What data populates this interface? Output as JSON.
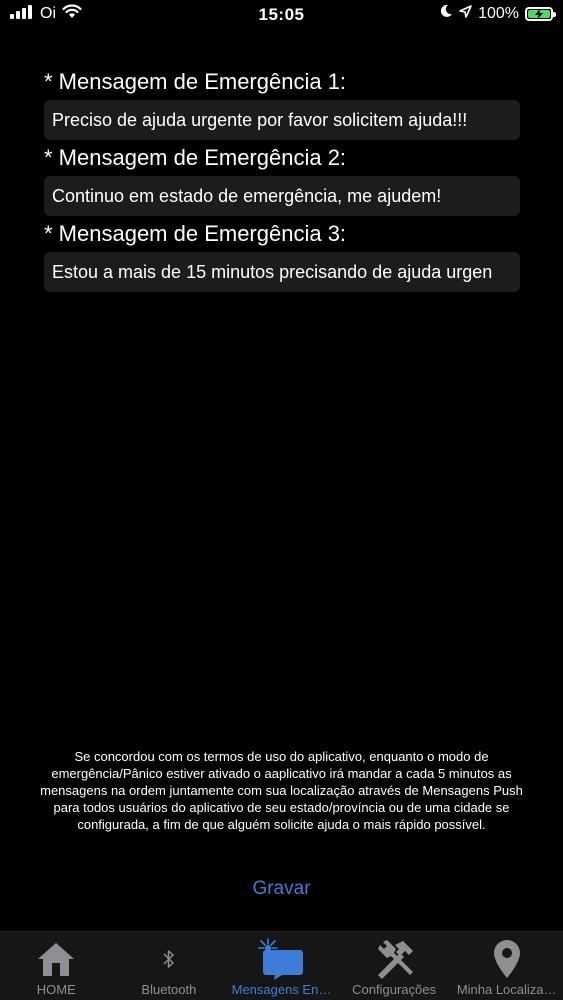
{
  "status_bar": {
    "carrier": "Oi",
    "time": "15:05",
    "battery": "100%"
  },
  "messages": [
    {
      "label": "* Mensagem de Emergência 1:",
      "value": "Preciso de ajuda urgente por favor solicitem ajuda!!!"
    },
    {
      "label": "* Mensagem de Emergência 2:",
      "value": "Continuo em estado de emergência, me ajudem!"
    },
    {
      "label": "* Mensagem de Emergência 3:",
      "value": "Estou a mais de 15 minutos precisando de ajuda urgen"
    }
  ],
  "disclaimer": "Se concordou com os termos de uso do aplicativo, enquanto o modo de emergência/Pânico estiver ativado o aaplicativo irá mandar a cada 5 minutos as mensagens na ordem juntamente com sua localização através de Mensagens Push para todos usuários do aplicativo de seu estado/província ou de uma cidade se configurada, a fim de que alguém solicite ajuda o mais rápido possível.",
  "save_label": "Gravar",
  "tabs": [
    {
      "label": "HOME",
      "icon": "home-icon"
    },
    {
      "label": "Bluetooth",
      "icon": "bluetooth-icon"
    },
    {
      "label": "Mensagens En…",
      "icon": "messages-icon",
      "active": true
    },
    {
      "label": "Configurações",
      "icon": "tools-icon"
    },
    {
      "label": "Minha Localiza…",
      "icon": "location-pin-icon"
    }
  ],
  "colors": {
    "accent": "#3d7dd8",
    "inactive_tab": "#8e8e93",
    "battery": "#4cd964",
    "field_bg": "#1c1c1e"
  }
}
